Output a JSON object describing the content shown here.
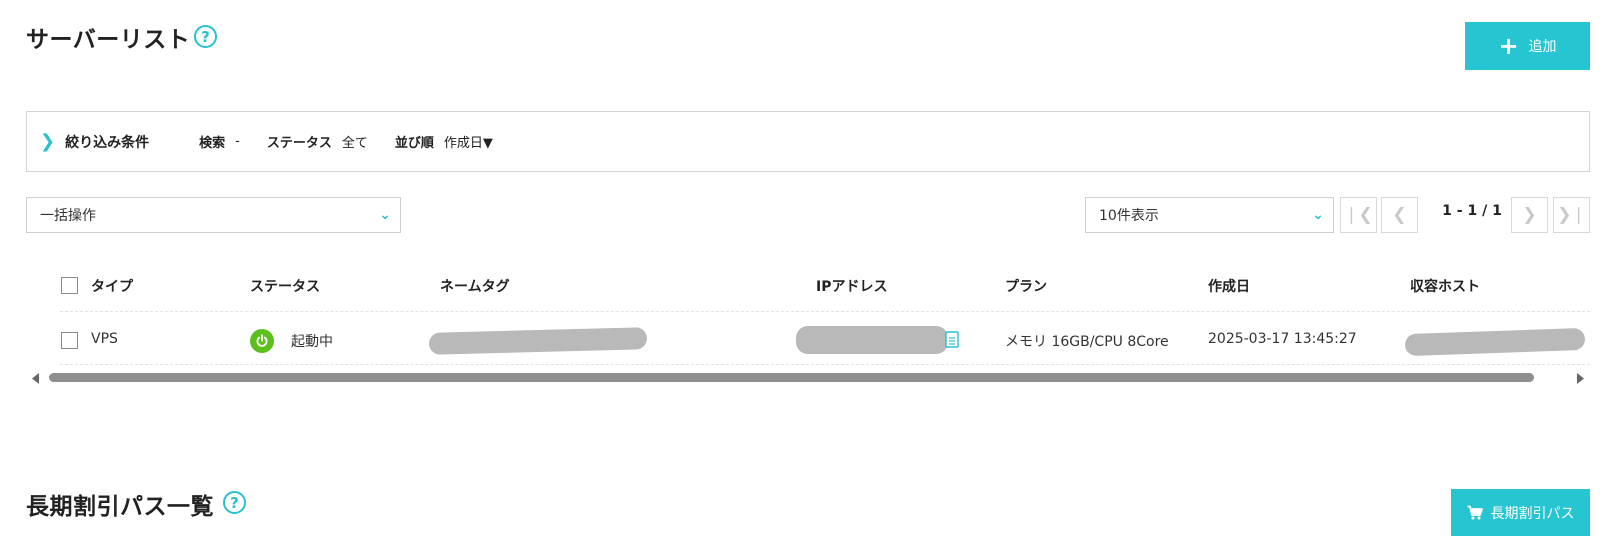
{
  "header": {
    "title": "サーバーリスト",
    "help_glyph": "?",
    "add_button_icon": "+",
    "add_button_label": "追加"
  },
  "filter": {
    "expand_icon": "❯",
    "title": "絞り込み条件",
    "search_key": "検索",
    "search_value": "-",
    "status_key": "ステータス",
    "status_value": "全て",
    "sort_key": "並び順",
    "sort_value": "作成日▼"
  },
  "bulk_select": {
    "value": "一括操作",
    "chevron": "⌄"
  },
  "page_size_select": {
    "value": "10件表示",
    "chevron": "⌄"
  },
  "pagination": {
    "first": "❘❮",
    "prev": "❮",
    "info": "1 - 1 / 1",
    "next": "❯",
    "last": "❯❘"
  },
  "table": {
    "columns": [
      "タイプ",
      "ステータス",
      "ネームタグ",
      "IPアドレス",
      "プラン",
      "作成日",
      "収容ホスト"
    ],
    "rows": [
      {
        "type": "VPS",
        "status": "起動中",
        "plan": "メモリ 16GB/CPU 8Core",
        "created": "2025-03-17 13:45:27"
      }
    ]
  },
  "pass_section": {
    "title": "長期割引パス一覧",
    "help_glyph": "?",
    "button_label": "長期割引パス"
  },
  "colors": {
    "accent": "#27c4d2",
    "status_running": "#5cbf1c",
    "redacted": "#b9b9b9"
  }
}
